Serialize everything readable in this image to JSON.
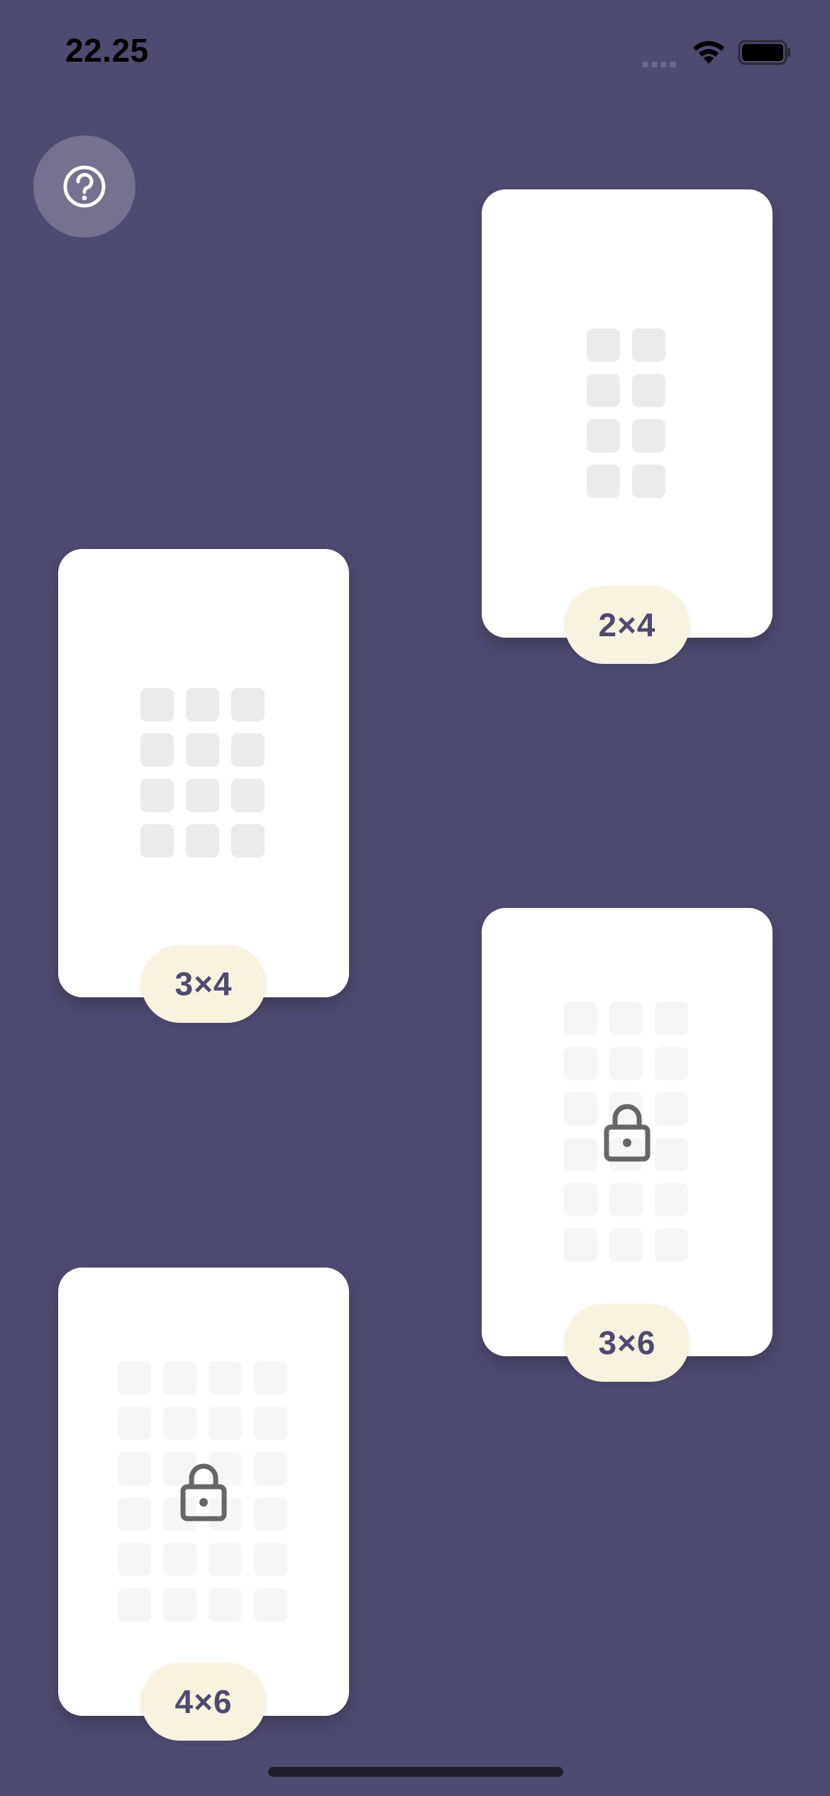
{
  "status_bar": {
    "time": "22.25",
    "icons": [
      "signal-icon",
      "wifi-icon",
      "battery-icon"
    ]
  },
  "help_button": {
    "icon": "question-circle-icon"
  },
  "levels": [
    {
      "label": "2×4",
      "columns": 2,
      "rows": 4,
      "locked": false
    },
    {
      "label": "3×4",
      "columns": 3,
      "rows": 4,
      "locked": false
    },
    {
      "label": "3×6",
      "columns": 3,
      "rows": 6,
      "locked": true,
      "icon": "lock-icon"
    },
    {
      "label": "4×6",
      "columns": 4,
      "rows": 6,
      "locked": true,
      "icon": "lock-icon"
    }
  ],
  "colors": {
    "background": "#4f4a70",
    "card": "#ffffff",
    "pill": "#f8f3df",
    "pill_text": "#4f4a70",
    "cell": "#ebebeb",
    "lock": "#666666"
  }
}
